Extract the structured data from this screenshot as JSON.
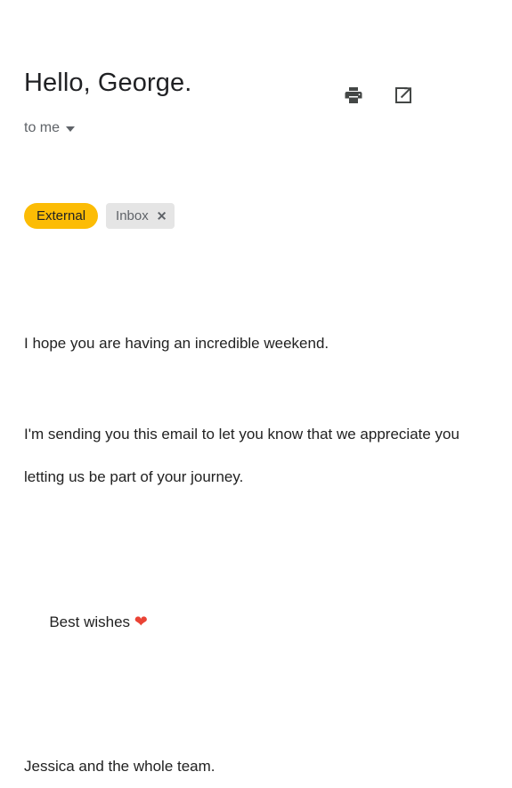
{
  "email": {
    "subject": "Hello, George.",
    "recipient": "to me",
    "actions": {
      "print_label": "Print",
      "open_new_window_label": "Open in new window"
    },
    "labels": [
      {
        "name": "External",
        "removable": false
      },
      {
        "name": "Inbox",
        "removable": true,
        "remove_glyph": "✕"
      }
    ],
    "body": {
      "paragraph_1": "I hope you are having an incredible weekend.",
      "paragraph_2": "I'm sending you this email to let you know that we appreciate you letting us be part of your journey.",
      "signoff": "Best wishes ",
      "signoff_emoji": "❤",
      "signature": "Jessica and the whole team."
    }
  },
  "colors": {
    "external_label_bg": "#fcbc05",
    "external_label_text": "#202124",
    "inbox_label_bg": "#e5e5e5",
    "inbox_label_text": "#5f6368",
    "subject_text": "#202124",
    "body_text": "#222222",
    "meta_text": "#5f6368",
    "icon": "#444746",
    "heart": "#ea4335",
    "background": "#ffffff"
  }
}
